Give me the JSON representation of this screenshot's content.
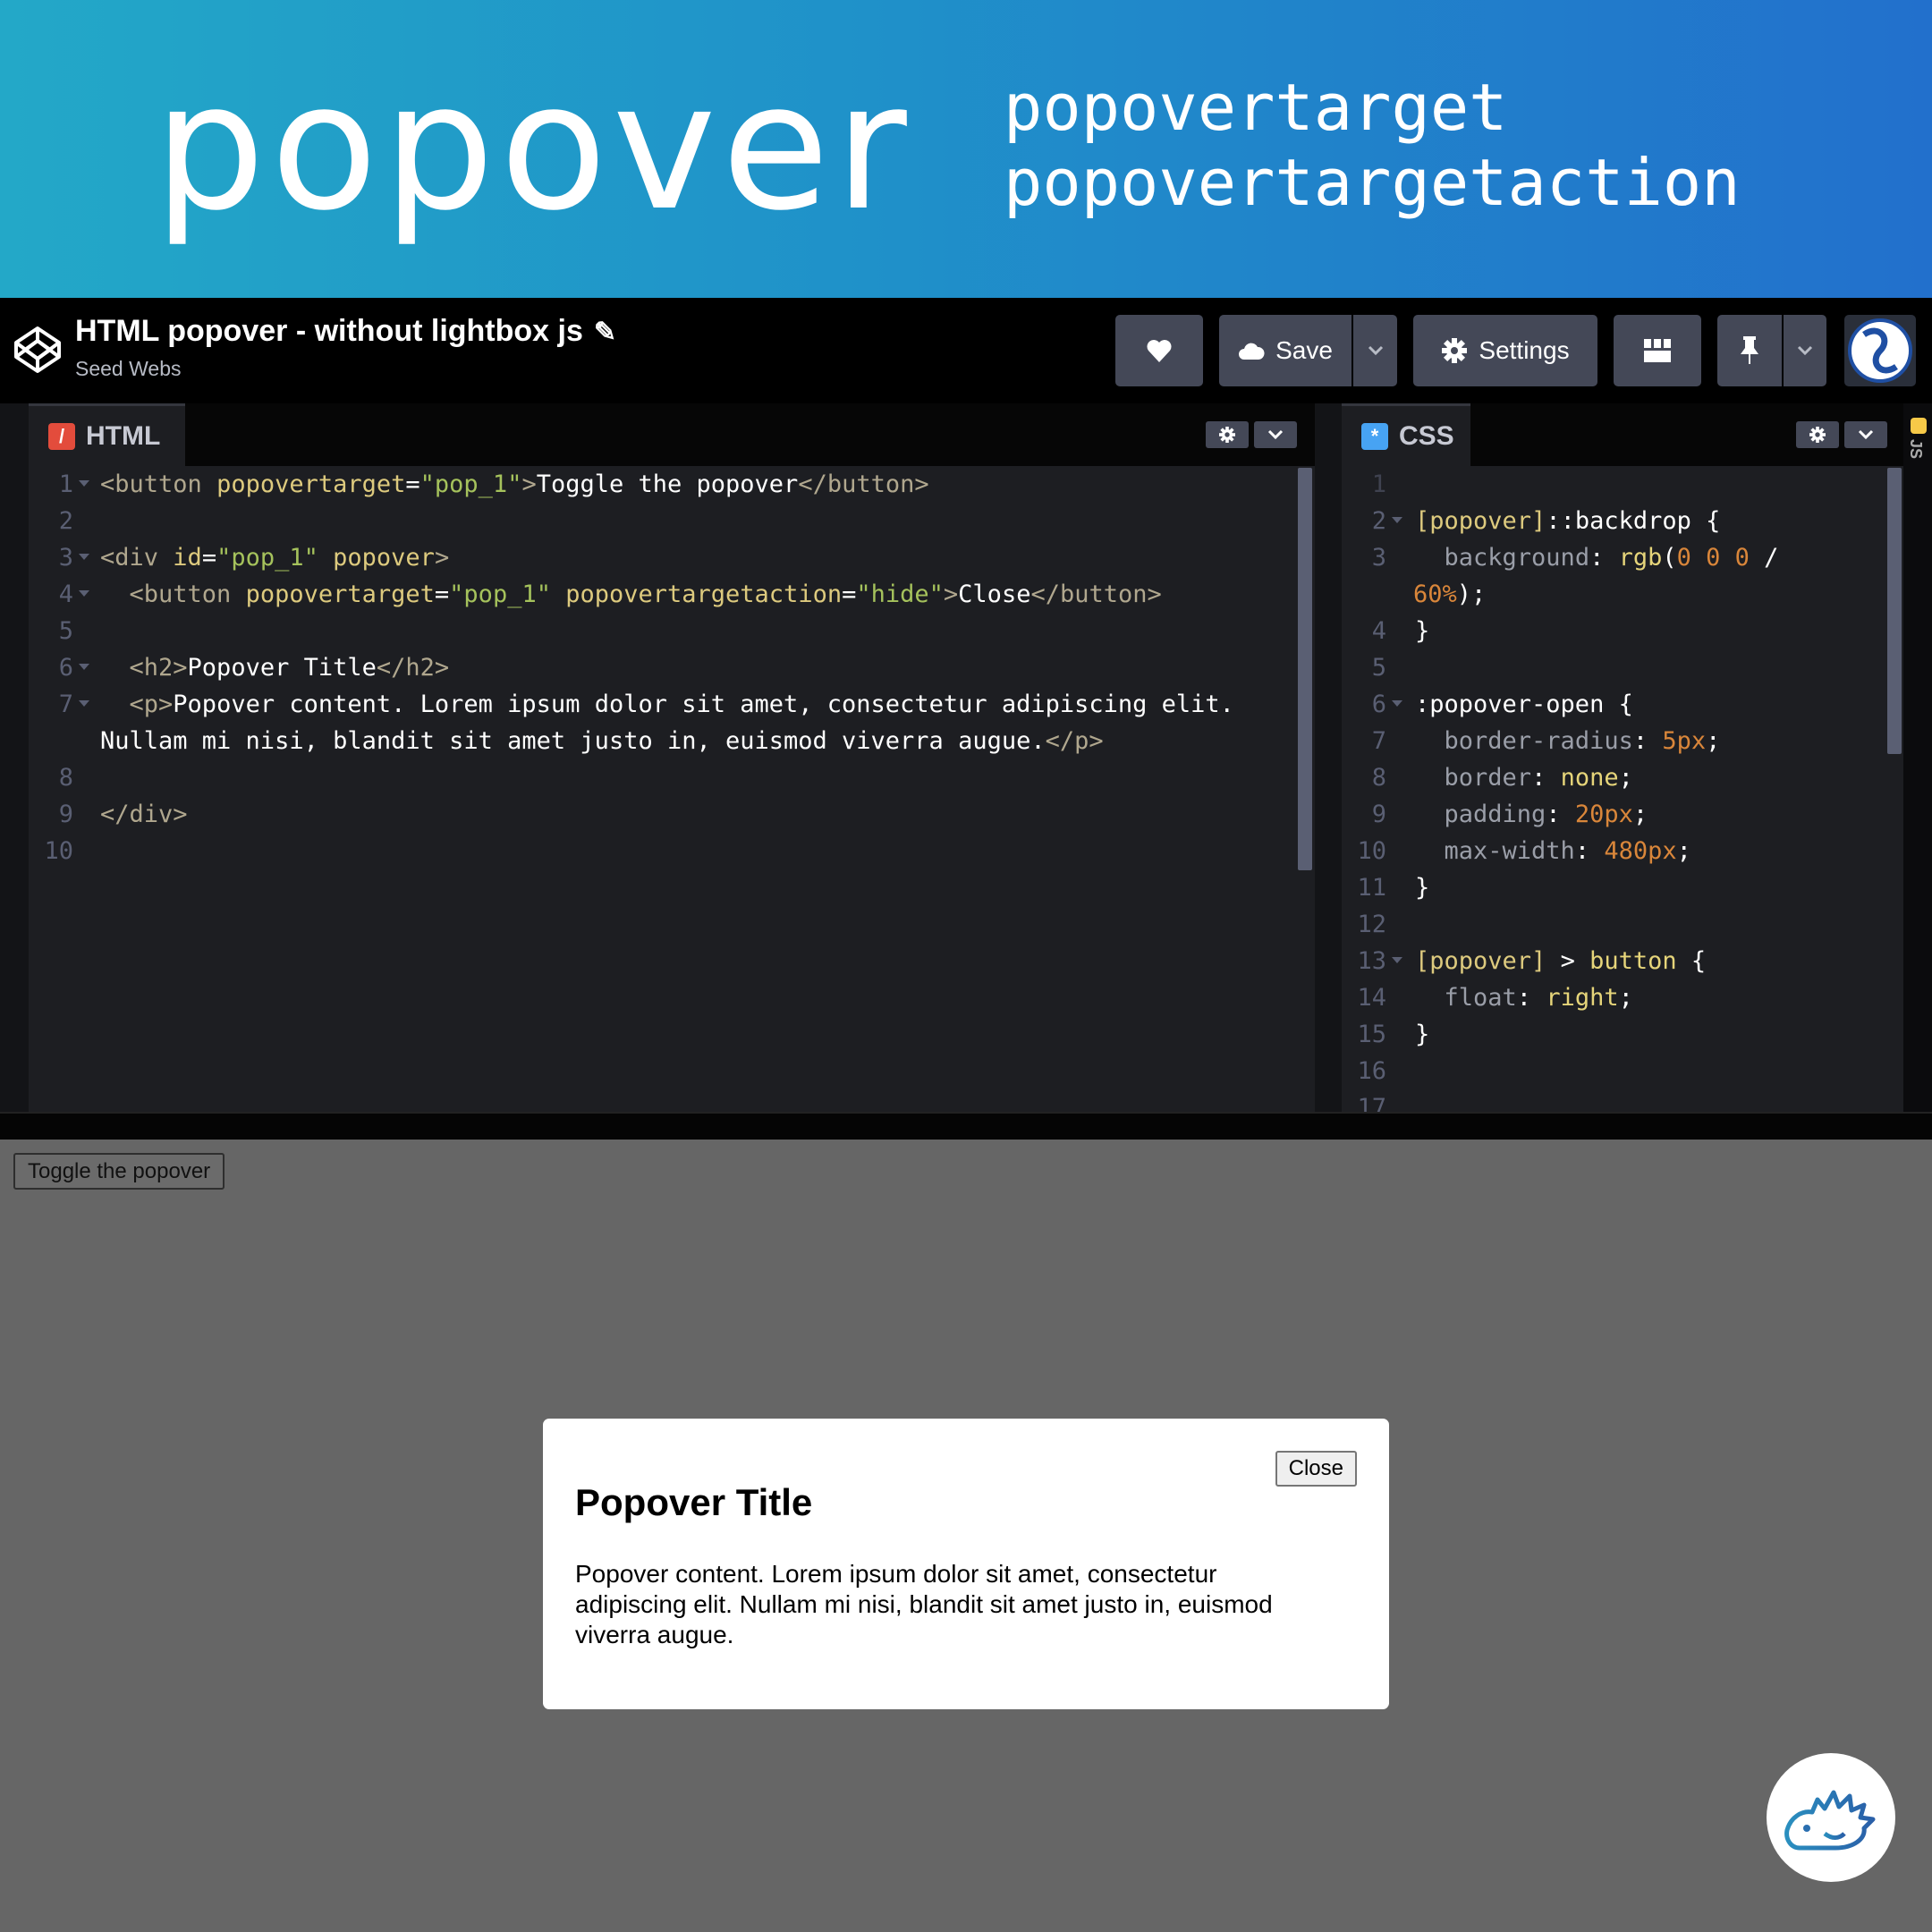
{
  "banner": {
    "title": "popover",
    "attrs": [
      "popovertarget",
      "popovertargetaction"
    ]
  },
  "header": {
    "pen_title": "HTML popover - without lightbox js",
    "author": "Seed Webs",
    "save_label": "Save",
    "settings_label": "Settings"
  },
  "editors": {
    "html_tab": "HTML",
    "css_tab": "CSS",
    "js_strip": "JS"
  },
  "preview": {
    "toggle_label": "Toggle the popover",
    "close_label": "Close",
    "popover_title": "Popover Title",
    "popover_text": "Popover content. Lorem ipsum dolor sit amet, consectetur adipiscing elit. Nullam mi nisi, blandit sit amet justo in, euismod viverra augue."
  },
  "colors": {
    "html_icon": "#e34c3c",
    "css_icon": "#47a3f3",
    "button_bg": "#444857",
    "preview_bg": "#666666"
  }
}
